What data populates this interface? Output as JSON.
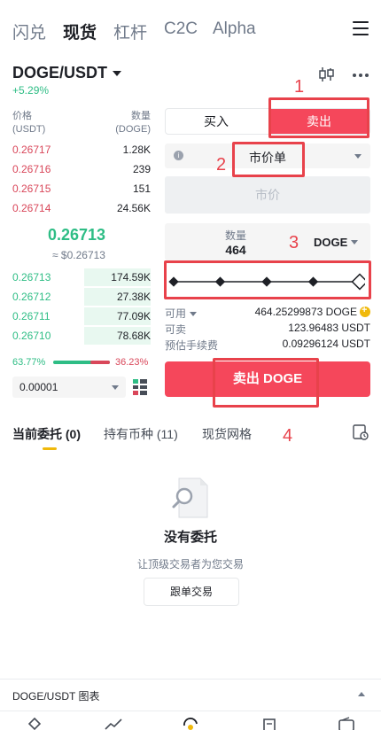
{
  "topnav": {
    "tabs": [
      {
        "label": "闪兑",
        "active": false
      },
      {
        "label": "现货",
        "active": true
      },
      {
        "label": "杠杆",
        "active": false
      },
      {
        "label": "C2C",
        "active": false
      },
      {
        "label": "Alpha",
        "active": false
      }
    ],
    "menu_icon": "hamburger-menu-icon"
  },
  "pair": {
    "symbol": "DOGE/USDT",
    "change": "+5.29%",
    "icons": [
      "candlestick-chart-icon",
      "more-dots-icon"
    ]
  },
  "orderbook": {
    "price_header": "价格",
    "price_unit": "(USDT)",
    "qty_header": "数量",
    "qty_unit": "(DOGE)",
    "asks": [
      {
        "price": "0.26717",
        "qty": "1.28K"
      },
      {
        "price": "0.26716",
        "qty": "239"
      },
      {
        "price": "0.26715",
        "qty": "151"
      },
      {
        "price": "0.26714",
        "qty": "24.56K"
      }
    ],
    "last_price": "0.26713",
    "last_price_usd": "≈ $0.26713",
    "bids": [
      {
        "price": "0.26713",
        "qty": "174.59K",
        "depth": 0.48
      },
      {
        "price": "0.26712",
        "qty": "27.38K",
        "depth": 0.48
      },
      {
        "price": "0.26711",
        "qty": "77.09K",
        "depth": 0.48
      },
      {
        "price": "0.26710",
        "qty": "78.68K",
        "depth": 0.48
      }
    ],
    "buy_ratio": "63.77%",
    "sell_ratio": "36.23%",
    "precision": "0.00001"
  },
  "form": {
    "buy_label": "买入",
    "sell_label": "卖出",
    "order_type": "市价单",
    "market_price_placeholder": "市价",
    "qty_label": "数量",
    "qty_value": "464",
    "qty_unit": "DOGE",
    "slider_percent": 100,
    "available_label": "可用",
    "available_value": "464.25299873 DOGE",
    "sellable_label": "可卖",
    "sellable_value": "123.96483 USDT",
    "fee_label": "预估手续费",
    "fee_value": "0.09296124 USDT",
    "submit_label": "卖出 DOGE"
  },
  "annotations": {
    "n1": "1",
    "n2": "2",
    "n3": "3",
    "n4": "4",
    "color": "#e8424b"
  },
  "orders": {
    "tabs": [
      {
        "label": "当前委托 (0)",
        "active": true
      },
      {
        "label": "持有币种 (11)",
        "active": false
      },
      {
        "label": "现货网格",
        "active": false
      }
    ],
    "empty_title": "没有委托",
    "empty_sub": "让顶级交易者为您交易",
    "follow_button": "跟单交易"
  },
  "chart_bar": {
    "label": "DOGE/USDT 图表"
  },
  "colors": {
    "green": "#2ebd85",
    "red": "#f5475b",
    "accent": "#f0b90b"
  }
}
